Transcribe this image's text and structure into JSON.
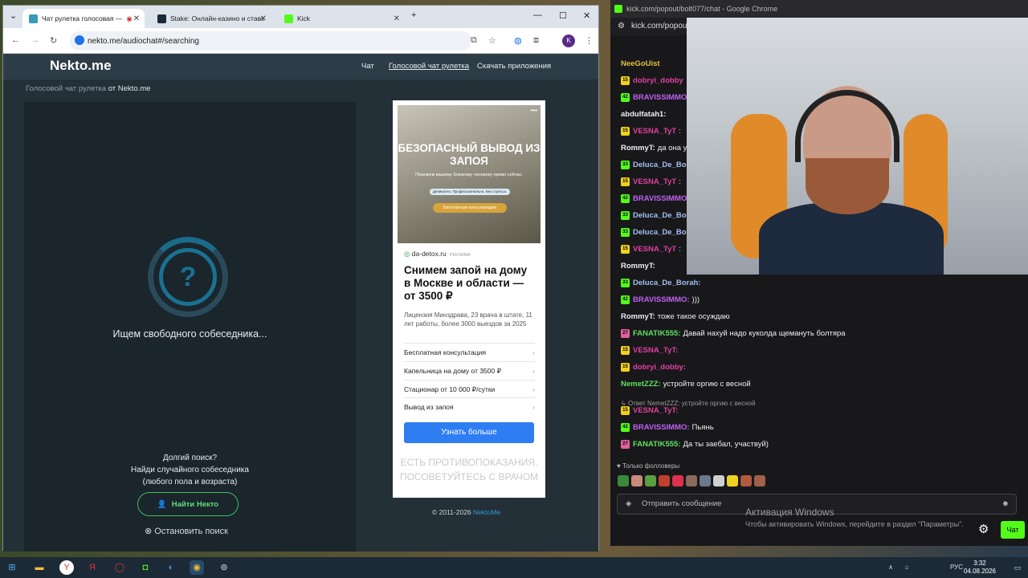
{
  "left_browser": {
    "tabs": [
      {
        "label": "Чат рулетка голосовая — "
      },
      {
        "label": "Stake: Онлайн-казино и ставк"
      },
      {
        "label": "Kick"
      }
    ],
    "url": "nekto.me/audiochat#/searching",
    "avatar_letter": "K"
  },
  "site": {
    "logo": "Nekto.me",
    "menu": [
      "Чат",
      "Голосовой чат рулетка",
      "Скачать приложения"
    ],
    "breadcrumb_link": "Голосовой чат рулетка",
    "breadcrumb_rest": "от Nekto.me",
    "question_mark": "?",
    "searching_text": "Ищем свободного собеседника...",
    "long_search": "Долгий поиск?",
    "find_random": "Найди случайного собеседника",
    "any_gender": "(любого пола и возраста)",
    "find_button": "Найти Некто",
    "stop_search": "Остановить поиск",
    "copyright": "© 2011-2026",
    "copyright_brand": "NektoMe"
  },
  "ad": {
    "image_title": "БЕЗОПАСНЫЙ ВЫВОД ИЗ ЗАПОЯ",
    "image_sub": "Поможем вашему близкому человеку прямо сейчас.",
    "image_pill": "Деликатно. Профессионально. Без стресса.",
    "image_btn": "Бесплатная консультация",
    "domain": "da-detox.ru",
    "ad_label": "РЕКЛАМА",
    "headline": "Снимем запой на дому в Москве и области — от 3500 ₽",
    "desc": "Лицензия Минздрава, 23 врача в штате, 11 лет работы, более 3000 выездов за 2025",
    "links": [
      "Бесплатная консультация",
      "Капельница на дому от 3500 ₽",
      "Стационар от 10 000 ₽/сутки",
      "Вывод из запоя"
    ],
    "cta": "Узнать больше",
    "warning": "ЕСТЬ ПРОТИВОПОКАЗАНИЯ. ПОСОВЕТУЙТЕСЬ С ВРАЧОМ"
  },
  "right_window": {
    "title": "kick.com/popout/bolt077/chat - Google Chrome",
    "url": "kick.com/popout",
    "messages": [
      {
        "badge": "",
        "user": "NeeGoUist",
        "text": "",
        "color": "#e0c040"
      },
      {
        "badge": "15",
        "user": "dobryi_dobby",
        "text": "",
        "color": "#e040a0"
      },
      {
        "badge": "42",
        "user": "BRAVISSIMMO",
        "text": "",
        "color": "#c060f0"
      },
      {
        "badge": "",
        "user": "abdulfatah1:",
        "text": "",
        "color": "#efeff1"
      },
      {
        "badge": "15",
        "user": "VESNA_TyT",
        "text": ":",
        "color": "#e040a0"
      },
      {
        "badge": "",
        "user": "RommyT:",
        "text": "да она у",
        "color": "#efeff1"
      },
      {
        "badge": "33",
        "user": "Deluca_De_Bo",
        "text": "",
        "color": "#a0c0f0"
      },
      {
        "badge": "15",
        "user": "VESNA_TyT",
        "text": ":",
        "color": "#e040a0"
      },
      {
        "badge": "42",
        "user": "BRAVISSIMMO",
        "text": "",
        "color": "#c060f0"
      },
      {
        "badge": "33",
        "user": "Deluca_De_Bo",
        "text": "",
        "color": "#a0c0f0"
      },
      {
        "badge": "33",
        "user": "Deluca_De_Bo",
        "text": "",
        "color": "#a0c0f0"
      },
      {
        "badge": "15",
        "user": "VESNA_TyT",
        "text": ":",
        "color": "#e040a0"
      },
      {
        "badge": "",
        "user": "RommyT:",
        "text": "",
        "color": "#efeff1"
      },
      {
        "badge": "33",
        "user": "Deluca_De_Borah:",
        "text": "",
        "color": "#a0c0f0"
      },
      {
        "badge": "42",
        "user": "BRAVISSIMMO:",
        "text": ")))",
        "color": "#c060f0"
      },
      {
        "badge": "",
        "user": "RommyT:",
        "text": "тоже такое осуждаю",
        "color": "#efeff1"
      },
      {
        "badge": "27",
        "user": "FANATIK555:",
        "text": "Давай нахуй надо куколда щемануть болтяра",
        "color": "#60e060"
      },
      {
        "badge": "15",
        "user": "VESNA_TyT:",
        "text": "",
        "color": "#e040a0"
      },
      {
        "badge": "15",
        "user": "dobryi_dobby:",
        "text": "",
        "color": "#e040a0"
      },
      {
        "badge": "",
        "user": "NemetZZZ:",
        "text": "устройте оргию с весной",
        "color": "#60e060"
      },
      {
        "badge": "15",
        "user": "VESNA_TyT:",
        "text": "",
        "color": "#e040a0"
      },
      {
        "badge": "42",
        "user": "BRAVISSIMMO:",
        "text": "Пьянь",
        "color": "#c060f0"
      },
      {
        "badge": "27",
        "user": "FANATIK555:",
        "text": "Да ты заебал, участвуй)",
        "color": "#60e060"
      }
    ],
    "reply_note": "Ответ NemetZZZ: устройте оргию с весной",
    "followers_only": "Только фолловеры",
    "input_placeholder": "Отправить сообщение",
    "chat_button": "Чат",
    "activation_title": "Активация Windows",
    "activation_text": "Чтобы активировать Windows, перейдите в раздел \"Параметры\"."
  },
  "taskbar": {
    "time": "3:32",
    "date": "04.08.2026",
    "lang": "РУС"
  }
}
